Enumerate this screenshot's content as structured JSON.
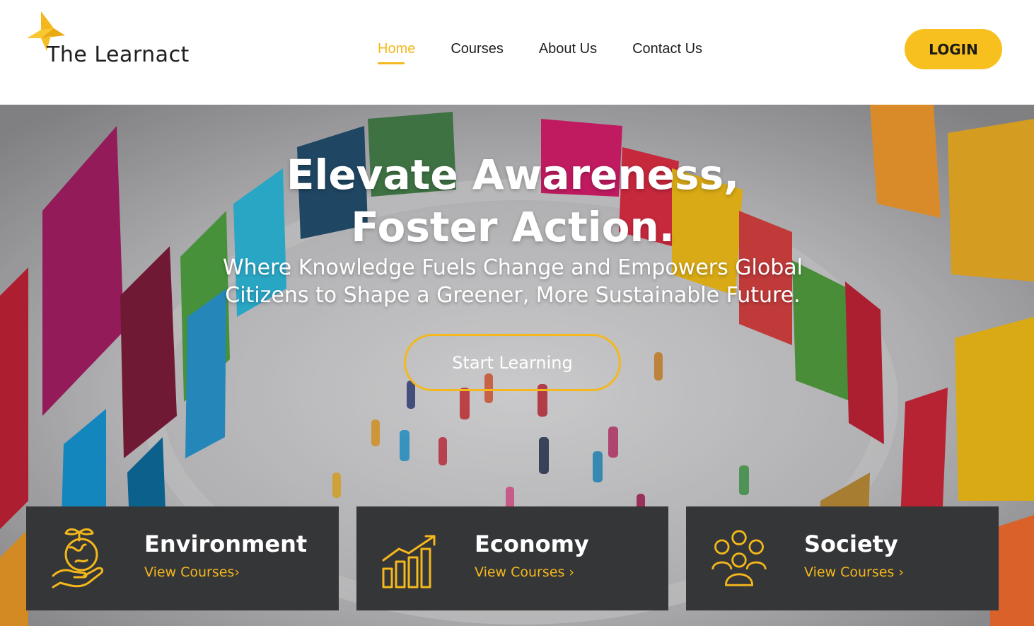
{
  "brand": {
    "name": "The Learnact",
    "logo_icon": "origami-arrow-icon",
    "accent": "#f4b81c"
  },
  "nav": {
    "items": [
      {
        "label": "Home",
        "active": true
      },
      {
        "label": "Courses",
        "active": false
      },
      {
        "label": "About Us",
        "active": false
      },
      {
        "label": "Contact Us",
        "active": false
      }
    ],
    "login_label": "LOGIN"
  },
  "hero": {
    "title_line1": "Elevate Awareness,",
    "title_line2": "Foster Action.",
    "subtitle_line1": "Where Knowledge Fuels Change and Empowers Global",
    "subtitle_line2": "Citizens to Shape a Greener, More Sustainable Future.",
    "cta_label": "Start Learning"
  },
  "categories": [
    {
      "title": "Environment",
      "link": "View Courses›",
      "icon": "earth-in-hand-icon"
    },
    {
      "title": "Economy",
      "link": "View Courses ›",
      "icon": "growth-chart-icon"
    },
    {
      "title": "Society",
      "link": "View Courses ›",
      "icon": "people-group-icon"
    }
  ]
}
